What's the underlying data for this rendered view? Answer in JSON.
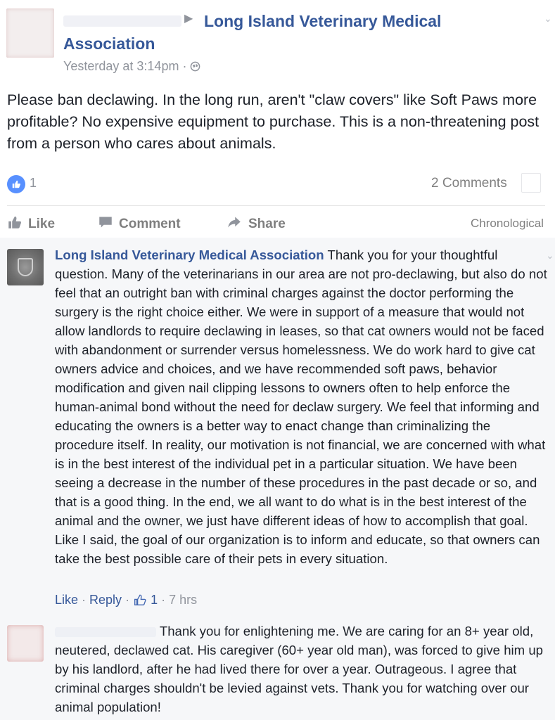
{
  "post": {
    "target": "Long Island Veterinary Medical Association",
    "time": "Yesterday at 3:14pm",
    "separator": "·",
    "caret": "▶",
    "text": "Please ban declawing. In the long run, aren't \"claw covers\" like Soft Paws more profitable? No expensive equipment to purchase. This is a non-threatening post from a person who cares about animals.",
    "like_count": "1",
    "comments_count": "2 Comments"
  },
  "actions": {
    "like": "Like",
    "comment": "Comment",
    "share": "Share",
    "sort": "Chronological"
  },
  "comments": [
    {
      "author": "Long Island Veterinary Medical Association",
      "text": "Thank you for your thoughtful question. Many of the veterinarians in our area are not pro-declawing, but also do not feel that an outright ban with criminal charges against the doctor performing the surgery is the right choice either. We were in support of a measure that would not allow landlords to require declawing in leases, so that cat owners would not be faced with abandonment or surrender versus homelessness. We do work hard to give cat owners advice and choices, and we have recommended soft paws, behavior modification and given nail clipping lessons to owners often to help enforce the human-animal bond without the need for declaw surgery. We feel that informing and educating the owners is a better way to enact change than criminalizing the procedure itself. In reality, our motivation is not financial, we are concerned with what is in the best interest of the individual pet in a particular situation. We have been seeing a decrease in the number of these procedures in the past decade or so, and that is a good thing. In the end, we all want to do what is in the best interest of the animal and the owner, we just have different ideas of how to accomplish that goal. Like I said, the goal of our organization is to inform and educate, so that owners can take the best possible care of their pets in every situation.",
      "like_label": "Like",
      "reply_label": "Reply",
      "likes": "1",
      "time": "7 hrs"
    },
    {
      "text": "Thank you for enlightening me. We are caring for an 8+ year old, neutered, declawed cat. His caregiver (60+ year old man), was forced to give him up by his landlord, after he had lived there for over a year. Outrageous. I agree that criminal charges shouldn't be levied against vets. Thank you for watching over our animal population!"
    }
  ],
  "icons": {
    "globe": "globe-icon",
    "like": "thumbs-up-icon",
    "comment": "speech-bubble-icon",
    "share": "share-arrow-icon"
  },
  "colors": {
    "link": "#365899",
    "muted": "#90949c",
    "like_blue": "#5890ff",
    "comment_bg": "#f6f7f9"
  }
}
